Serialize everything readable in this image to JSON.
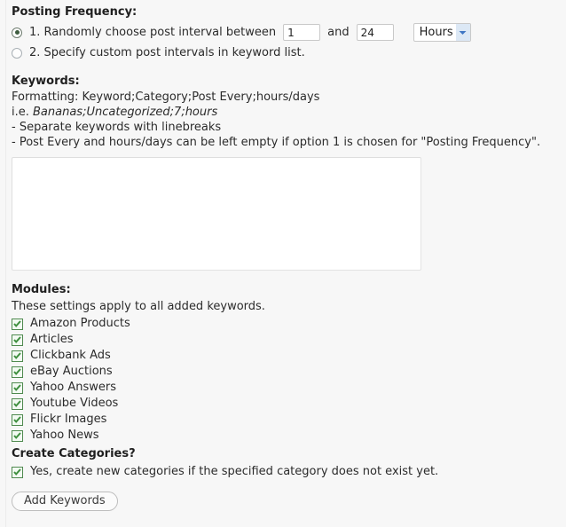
{
  "posting_frequency": {
    "heading": "Posting Frequency:",
    "option1": {
      "label_prefix": "1. Randomly choose post interval between",
      "min_value": "1",
      "conjunction": "and",
      "max_value": "24",
      "unit": "Hours",
      "selected": true
    },
    "option2": {
      "label": "2. Specify custom post intervals in keyword list.",
      "selected": false
    }
  },
  "keywords": {
    "heading": "Keywords:",
    "formatting_line": "Formatting: Keyword;Category;Post Every;hours/days",
    "example_prefix": "i.e. ",
    "example_text": "Bananas;Uncategorized;7;hours",
    "note1": "- Separate keywords with linebreaks",
    "note2": "- Post Every and hours/days can be left empty if option 1 is chosen for \"Posting Frequency\".",
    "textarea_value": "",
    "textarea_placeholder": ""
  },
  "modules": {
    "heading": "Modules:",
    "description": "These settings apply to all added keywords.",
    "items": [
      {
        "label": "Amazon Products",
        "checked": true
      },
      {
        "label": "Articles",
        "checked": true
      },
      {
        "label": "Clickbank Ads",
        "checked": true
      },
      {
        "label": "eBay Auctions",
        "checked": true
      },
      {
        "label": "Yahoo Answers",
        "checked": true
      },
      {
        "label": "Youtube Videos",
        "checked": true
      },
      {
        "label": "Flickr Images",
        "checked": true
      },
      {
        "label": "Yahoo News",
        "checked": true
      }
    ]
  },
  "create_categories": {
    "heading": "Create Categories?",
    "option": {
      "label": "Yes, create new categories if the specified category does not exist yet.",
      "checked": true
    }
  },
  "actions": {
    "add_keywords_label": "Add Keywords"
  },
  "colors": {
    "page_background": "#f7f7f7",
    "checkbox_border": "#4f8a4f",
    "checkbox_tick": "#3f8f3f",
    "radio_dot": "#3d5c3f",
    "dropdown_arrow": "#3f76c4"
  }
}
